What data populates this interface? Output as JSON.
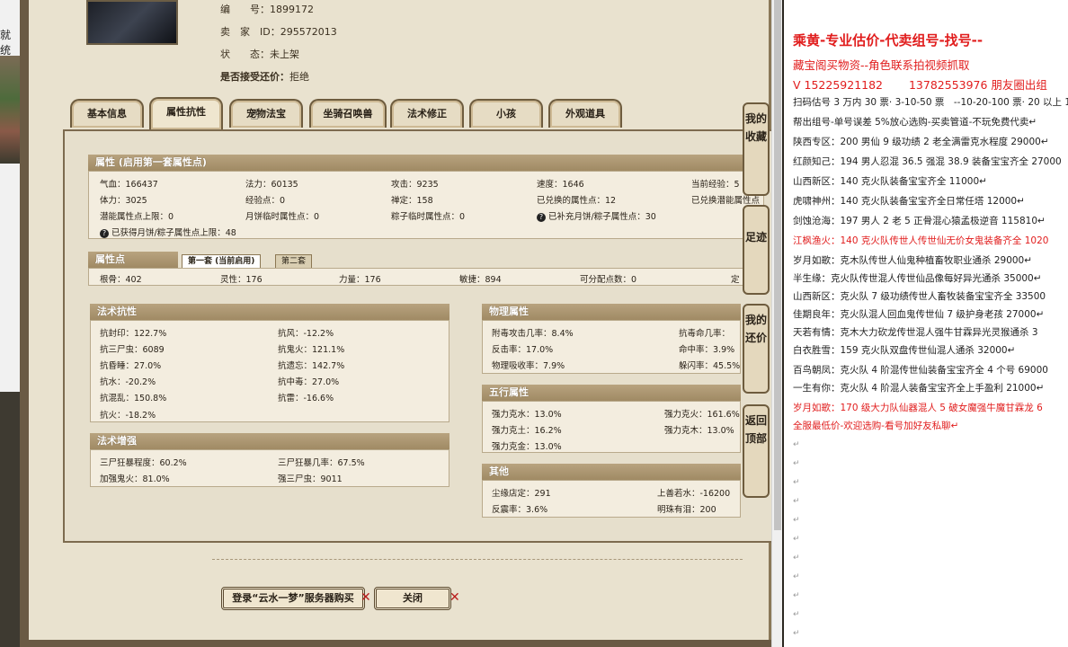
{
  "left_strip": {
    "text": "就统"
  },
  "top_info": {
    "number_label": "编　　号：",
    "number": "1899172",
    "seller_label": "卖　家　ID：",
    "seller": "295572013",
    "status_label": "状　　态：",
    "status": "未上架",
    "bargain_label": "是否接受还价：",
    "bargain": "拒绝"
  },
  "tabs": [
    "基本信息",
    "属性抗性",
    "宠物法宝",
    "坐骑召唤兽",
    "法术修正",
    "小孩",
    "外观道具"
  ],
  "attr_section": {
    "title": "属性 (启用第一套属性点)",
    "rows": [
      [
        "气血：166437",
        "法力：60135",
        "攻击：9235",
        "速度：1646",
        "当前经验：5"
      ],
      [
        "体力：3025",
        "经验点：0",
        "禅定：158",
        "已兑换的属性点：12",
        "已兑换潜能属性点"
      ],
      [
        "潜能属性点上限：0",
        "月饼临时属性点：0",
        "粽子临时属性点：0",
        "已补充月饼/粽子属性点：30",
        ""
      ],
      [
        "已获得月饼/粽子属性点上限：48"
      ]
    ]
  },
  "points_section": {
    "title": "属性点",
    "subtab_active": "第一套 (当前启用)",
    "subtab_other": "第二套",
    "values": [
      "根骨：402",
      "灵性：176",
      "力量：176",
      "敏捷：894",
      "可分配点数：0",
      "定"
    ]
  },
  "resist_section": {
    "title": "法术抗性",
    "left": [
      "抗封印：122.7%",
      "抗三尸虫：6089",
      "抗昏睡：27.0%",
      "抗水：-20.2%",
      "抗混乱：150.8%",
      "抗火：-18.2%"
    ],
    "right": [
      "抗风：-12.2%",
      "抗鬼火：121.1%",
      "抗遗忘：142.7%",
      "抗中毒：27.0%",
      "抗雷：-16.6%"
    ]
  },
  "enhance_section": {
    "title": "法术增强",
    "left": [
      "三尸狂暴程度：60.2%",
      "加强鬼火：81.0%"
    ],
    "right": [
      "三尸狂暴几率：67.5%",
      "强三尸虫：9011"
    ]
  },
  "physical_section": {
    "title": "物理属性",
    "left": [
      "附毒攻击几率：8.4%",
      "反击率：17.0%",
      "物理吸收率：7.9%"
    ],
    "right": [
      "抗毒命几率：",
      "命中率：3.9%",
      "躲闪率：45.5%"
    ]
  },
  "wuxing_section": {
    "title": "五行属性",
    "left": [
      "强力克水：13.0%",
      "强力克土：16.2%",
      "强力克金：13.0%"
    ],
    "right": [
      "强力克火：161.6%",
      "强力克木：13.0%"
    ]
  },
  "other_section": {
    "title": "其他",
    "left": [
      "尘缘店定：291",
      "反震率：3.6%"
    ],
    "right": [
      "上善若水：-16200",
      "明珠有泪：200"
    ]
  },
  "buttons": {
    "login": "登录“云水一梦”服务器购买",
    "close": "关闭"
  },
  "side_tabs": [
    "我的收藏",
    "足迹",
    "我的还价",
    "返回顶部"
  ],
  "doc": {
    "title": "乘黄-专业估价-代卖组号-找号--",
    "lines": [
      {
        "t": "藏宝阁买物资--角色联系拍视频抓取",
        "red": true
      },
      {
        "t": "V 15225921182　　 13782553976 朋友圈出组",
        "red": true
      },
      {
        "t": "扫码估号 3 万内 30 票· 3-10-50 票　--10-20-100 票· 20 以上 1",
        "red": false
      },
      {
        "t": "帮出组号-单号误差 5%放心选购-买卖管道-不玩免费代卖↵",
        "red": false
      },
      {
        "t": "陕西专区：200 男仙 9 级功绩 2 老全满雷克水程度 29000↵",
        "red": false
      },
      {
        "t": "红颜知己：194 男人忍混 36.5 强混 38.9 装备宝宝齐全 27000",
        "red": false
      },
      {
        "t": "山西新区：140 克火队装备宝宝齐全 11000↵",
        "red": false
      },
      {
        "t": "虎啸神州：140 克火队装备宝宝齐全日常任塔 12000↵",
        "red": false
      },
      {
        "t": "剑蚀沧海：197 男人 2 老 5 正骨混心猿孟极逆音 115810↵",
        "red": false
      },
      {
        "t": "江枫渔火：140 克火队传世人传世仙无价女鬼装备齐全 1020",
        "red": true
      },
      {
        "t": "岁月如歌：克木队传世人仙鬼种植畜牧职业通杀 29000↵",
        "red": false
      },
      {
        "t": "半生缘：克火队传世混人传世仙品像每好异光通杀 35000↵",
        "red": false
      },
      {
        "t": "山西新区：克火队 7 级功绩传世人畜牧装备宝宝齐全 33500",
        "red": false
      },
      {
        "t": "佳期良年：克火队混人回血鬼传世仙 7 级护身老孩 27000↵",
        "red": false
      },
      {
        "t": "天若有情：克木大力砍龙传世混人强牛甘霖异光灵猴通杀 3",
        "red": false
      },
      {
        "t": "白衣胜雪：159 克火队双盘传世仙混人通杀 32000↵",
        "red": false
      },
      {
        "t": "百鸟朝凤：克火队 4 阶混传世仙装备宝宝齐全 4 个号 69000",
        "red": false
      },
      {
        "t": "一生有你：克火队 4 阶混人装备宝宝齐全上手盈利 21000↵",
        "red": false
      },
      {
        "t": "岁月如歌：170 级大力队仙器混人 5 破女魔强牛魔甘霖龙 6",
        "red": true
      },
      {
        "t": "全服最低价-欢迎选购-看号加好友私聊↵",
        "red": true
      }
    ],
    "return_mark": "↵"
  }
}
